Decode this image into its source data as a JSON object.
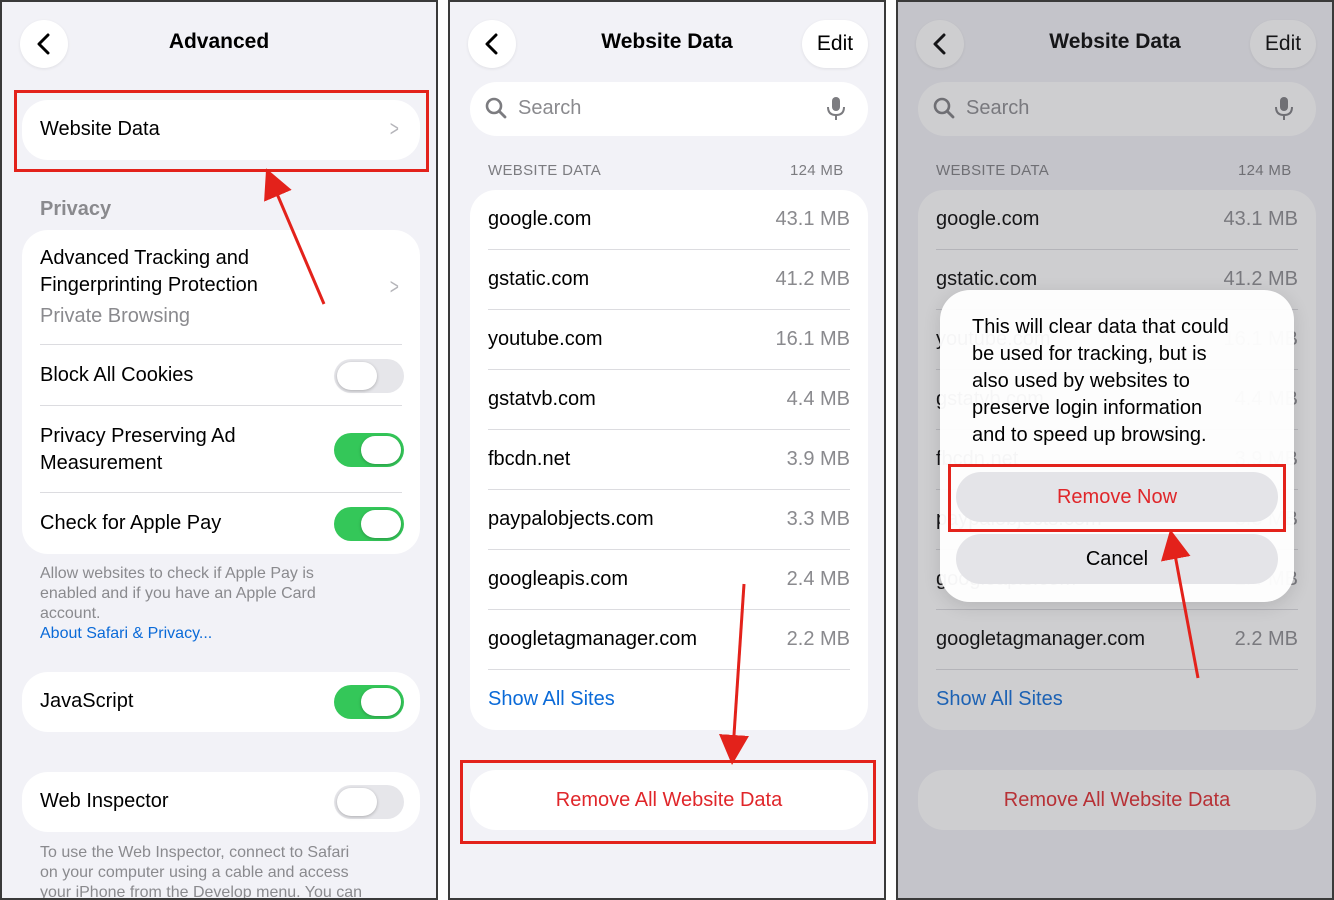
{
  "advanced": {
    "title": "Advanced",
    "website_data_label": "Website Data",
    "privacy_header": "Privacy",
    "tracking_label_line1": "Advanced Tracking and",
    "tracking_label_line2": "Fingerprinting Protection",
    "tracking_value": "Private Browsing",
    "block_cookies_label": "Block All Cookies",
    "block_cookies_on": false,
    "ad_measure_line1": "Privacy Preserving Ad",
    "ad_measure_line2": "Measurement",
    "ad_measure_on": true,
    "apple_pay_label": "Check for Apple Pay",
    "apple_pay_on": true,
    "privacy_footer_line1": "Allow websites to check if Apple Pay is",
    "privacy_footer_line2": "enabled and if you have an Apple Card",
    "privacy_footer_line3": "account.",
    "privacy_link": "About Safari & Privacy...",
    "javascript_label": "JavaScript",
    "javascript_on": true,
    "web_inspector_label": "Web Inspector",
    "web_inspector_on": false,
    "inspector_footer_line1": "To use the Web Inspector, connect to Safari",
    "inspector_footer_line2": "on your computer using a cable and access",
    "inspector_footer_line3": "your iPhone from the Develop menu. You can"
  },
  "website_data": {
    "title": "Website Data",
    "edit_label": "Edit",
    "search_placeholder": "Search",
    "section_header": "WEBSITE DATA",
    "total_size": "124 MB",
    "sites": [
      {
        "name": "google.com",
        "size": "43.1 MB"
      },
      {
        "name": "gstatic.com",
        "size": "41.2 MB"
      },
      {
        "name": "youtube.com",
        "size": "16.1 MB"
      },
      {
        "name": "gstatvb.com",
        "size": "4.4 MB"
      },
      {
        "name": "fbcdn.net",
        "size": "3.9 MB"
      },
      {
        "name": "paypalobjects.com",
        "size": "3.3 MB"
      },
      {
        "name": "googleapis.com",
        "size": "2.4 MB"
      },
      {
        "name": "googletagmanager.com",
        "size": "2.2 MB"
      }
    ],
    "show_all": "Show All Sites",
    "remove_all": "Remove All Website Data"
  },
  "alert": {
    "msg_line1": "This will clear data that could",
    "msg_line2": "be used for tracking, but is",
    "msg_line3": "also used by websites to",
    "msg_line4": "preserve login information",
    "msg_line5": "and to speed up browsing.",
    "remove_now": "Remove Now",
    "cancel": "Cancel"
  },
  "colors": {
    "accent_blue": "#0a6ad8",
    "destructive_red": "#e0262a",
    "toggle_green": "#34c759",
    "annotation_red": "#e3221b"
  }
}
